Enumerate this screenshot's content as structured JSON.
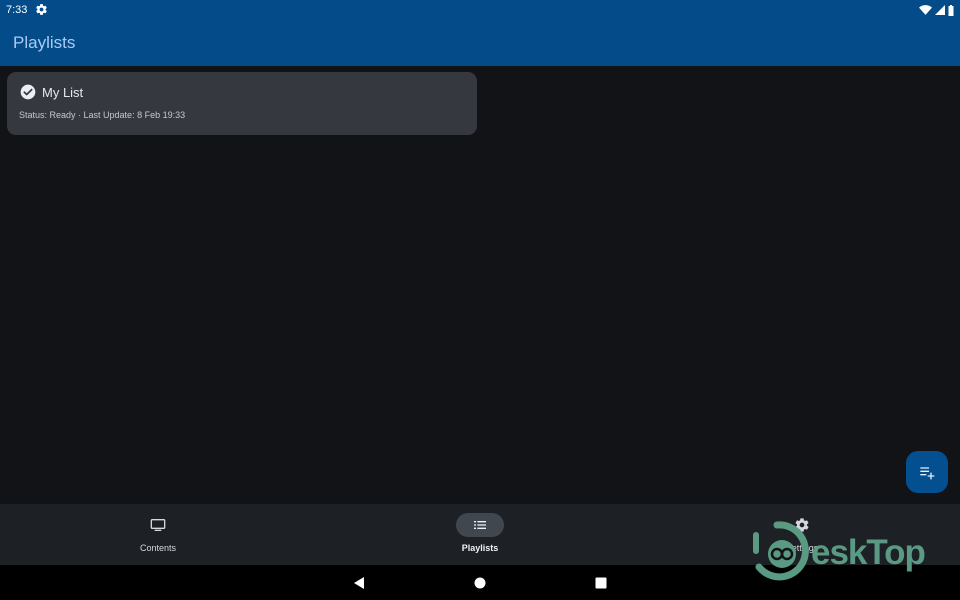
{
  "status_bar": {
    "time": "7:33",
    "icons": [
      "settings-icon",
      "wifi-icon",
      "signal-icon",
      "battery-icon"
    ]
  },
  "app_bar": {
    "title": "Playlists"
  },
  "playlist": {
    "name": "My List",
    "meta": "Status: Ready · Last Update: 8 Feb 19:33",
    "icon": "check-circle-icon"
  },
  "fab": {
    "icon": "playlist-add-icon"
  },
  "bottom_nav": {
    "items": [
      {
        "label": "Contents",
        "icon": "tv-icon"
      },
      {
        "label": "Playlists",
        "icon": "list-icon"
      },
      {
        "label": "Settings",
        "icon": "settings-icon"
      }
    ],
    "active_index": 1
  },
  "system_nav": {
    "buttons": [
      "back-icon",
      "home-icon",
      "recents-icon"
    ]
  },
  "watermark": {
    "text": "eskTop"
  },
  "colors": {
    "app_bar": "#034b89",
    "title": "#a9cbf3",
    "background": "#121316",
    "card": "#363840",
    "nav_bar": "#1d2024",
    "fab": "#044f90",
    "watermark": "#5a9a82"
  }
}
